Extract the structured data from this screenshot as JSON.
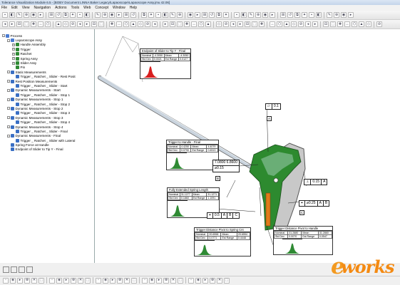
{
  "window": {
    "title": "Tolerance Visualization Module 6.5 - [BOBY Document LINNA Baker Legacy\\Lapaoscope\\Lapaoscope Assy.jmu 42.06]"
  },
  "menu": [
    "File",
    "Edit",
    "View",
    "Navigation",
    "Actions",
    "Tools",
    "Web",
    "Concept",
    "Window",
    "Help"
  ],
  "tree": [
    {
      "label": "Process",
      "depth": 0,
      "icon": "process-icon",
      "expander": "-"
    },
    {
      "label": "Laparoscope Assy",
      "depth": 1,
      "icon": "assembly-icon",
      "expander": "-"
    },
    {
      "label": "Handle Assembly",
      "depth": 2,
      "icon": "part-icon",
      "expander": "+"
    },
    {
      "label": "Trigger",
      "depth": 2,
      "icon": "part-icon",
      "expander": "+"
    },
    {
      "label": "Ratchet",
      "depth": 2,
      "icon": "part-icon",
      "expander": "+"
    },
    {
      "label": "Spring Assy",
      "depth": 2,
      "icon": "part-icon",
      "expander": "+"
    },
    {
      "label": "Slider Assy",
      "depth": 2,
      "icon": "part-icon",
      "expander": "+"
    },
    {
      "label": "Pin",
      "depth": 2,
      "icon": "part-icon",
      "expander": ""
    },
    {
      "label": "Static Measurements",
      "depth": 1,
      "icon": "measure-icon",
      "expander": "-"
    },
    {
      "label": "Trigger _ Ratchet _ Slider - Rest Posit",
      "depth": 2,
      "icon": "measure-icon",
      "expander": ""
    },
    {
      "label": "Rest Position Measurements",
      "depth": 1,
      "icon": "measure-icon",
      "expander": "-"
    },
    {
      "label": "Trigger _ Ratchet _ Slider - Start",
      "depth": 2,
      "icon": "measure-icon",
      "expander": ""
    },
    {
      "label": "Dynamic Measurements - Start",
      "depth": 1,
      "icon": "measure-icon",
      "expander": "-"
    },
    {
      "label": "Trigger _ Ratchet _ Slider - Stop 1",
      "depth": 2,
      "icon": "measure-icon",
      "expander": ""
    },
    {
      "label": "Dynamic Measurements - Stop 1",
      "depth": 1,
      "icon": "measure-icon",
      "expander": "-"
    },
    {
      "label": "Trigger _ Ratchet _ Slider - Stop 2",
      "depth": 2,
      "icon": "measure-icon",
      "expander": ""
    },
    {
      "label": "Dynamic Measurements - Stop 2",
      "depth": 1,
      "icon": "measure-icon",
      "expander": "-"
    },
    {
      "label": "Trigger _ Ratchet _ Slider - Stop 3",
      "depth": 2,
      "icon": "measure-icon",
      "expander": ""
    },
    {
      "label": "Dynamic Measurements - Stop 3",
      "depth": 1,
      "icon": "measure-icon",
      "expander": "-"
    },
    {
      "label": "Trigger _ Ratchet _ Slider - Stop 4",
      "depth": 2,
      "icon": "measure-icon",
      "expander": ""
    },
    {
      "label": "Dynamic Measurements - Stop 4",
      "depth": 1,
      "icon": "measure-icon",
      "expander": "-"
    },
    {
      "label": "Trigger _ Ratchet _ Slider - Final",
      "depth": 2,
      "icon": "measure-icon",
      "expander": ""
    },
    {
      "label": "Dynamic Measurements - Final",
      "depth": 1,
      "icon": "measure-icon",
      "expander": "-"
    },
    {
      "label": "Trigger _ Ratchet _ Slider with Lateral",
      "depth": 2,
      "icon": "measure-icon",
      "expander": ""
    },
    {
      "label": "Spring Force at Handle",
      "depth": 1,
      "icon": "measure-icon",
      "expander": ""
    },
    {
      "label": "Endpoint of Slider to Tip Y - Final",
      "depth": 1,
      "icon": "measure-icon",
      "expander": ""
    }
  ],
  "callouts": {
    "endpoint": {
      "title": "Endpoint of Slider to Tip Y - Final",
      "rows": [
        [
          "Nominal",
          "-4.3050",
          "Mean",
          "-4.3050"
        ],
        [
          "Std Dev",
          "0.0021",
          "Est Range",
          "0.0127"
        ]
      ],
      "color": "#d81e1e"
    },
    "trigger_handle": {
      "title": "Trigger to Handle - Final",
      "rows": [
        [
          "Nominal",
          "4.4250",
          "Mean",
          "4.4079"
        ],
        [
          "Std Dev",
          "0.0790",
          "Est Range",
          "0.4513"
        ]
      ],
      "color": "#2f8a34"
    },
    "spring": {
      "title": "Fully Extended Spring Length",
      "rows": [
        [
          "Nominal",
          "31.1277",
          "Mean",
          "31.1271"
        ],
        [
          "Std Dev",
          "0.1860",
          "Est Range",
          "1.1091"
        ]
      ],
      "color": "#2f8a34"
    },
    "pivot_spring": {
      "title": "Trigger Distance Pivot to Spring Cnt",
      "rows": [
        [
          "Nominal",
          "20.6558",
          "Mean",
          "20.6554"
        ],
        [
          "Std Dev",
          "0.0771",
          "Est Range",
          "0.4448"
        ]
      ],
      "color": "#2f8a34"
    },
    "pivot_handle": {
      "title": "Trigger Distance Pivot to Handle",
      "rows": [
        [
          "Nominal",
          "31.2880",
          "Mean",
          "31.2860"
        ],
        [
          "Std Dev",
          "0.0070",
          "Est Range",
          "0.0547"
        ]
      ],
      "color": "#2f8a34"
    }
  },
  "fcf": {
    "top": {
      "symbol": "⏥",
      "tol": "0.1"
    },
    "dim": {
      "value": "7.0800 6.8600",
      "tol": "⌀0.15"
    },
    "profile1": {
      "symbol": "⊥",
      "tol": "0.15",
      "datum": "A"
    },
    "position1": {
      "symbol": "⌖",
      "tol": "⌀0.25",
      "datum1": "A",
      "datum2": "B"
    },
    "position2": {
      "symbol": "⌖",
      "tol": "0.5",
      "datum1": "A",
      "datum2": "B",
      "datum3": "C"
    }
  },
  "datums": [
    "A",
    "B",
    "C"
  ],
  "logo": {
    "text": "works",
    "initial": "e"
  },
  "colors": {
    "trigger_body": "#2d8a2f",
    "handle_body": "#c8c8c8",
    "spring": "#e07a1a",
    "histogram_red": "#d81e1e",
    "histogram_green": "#2f8a34",
    "logo_orange": "#f39a21"
  }
}
